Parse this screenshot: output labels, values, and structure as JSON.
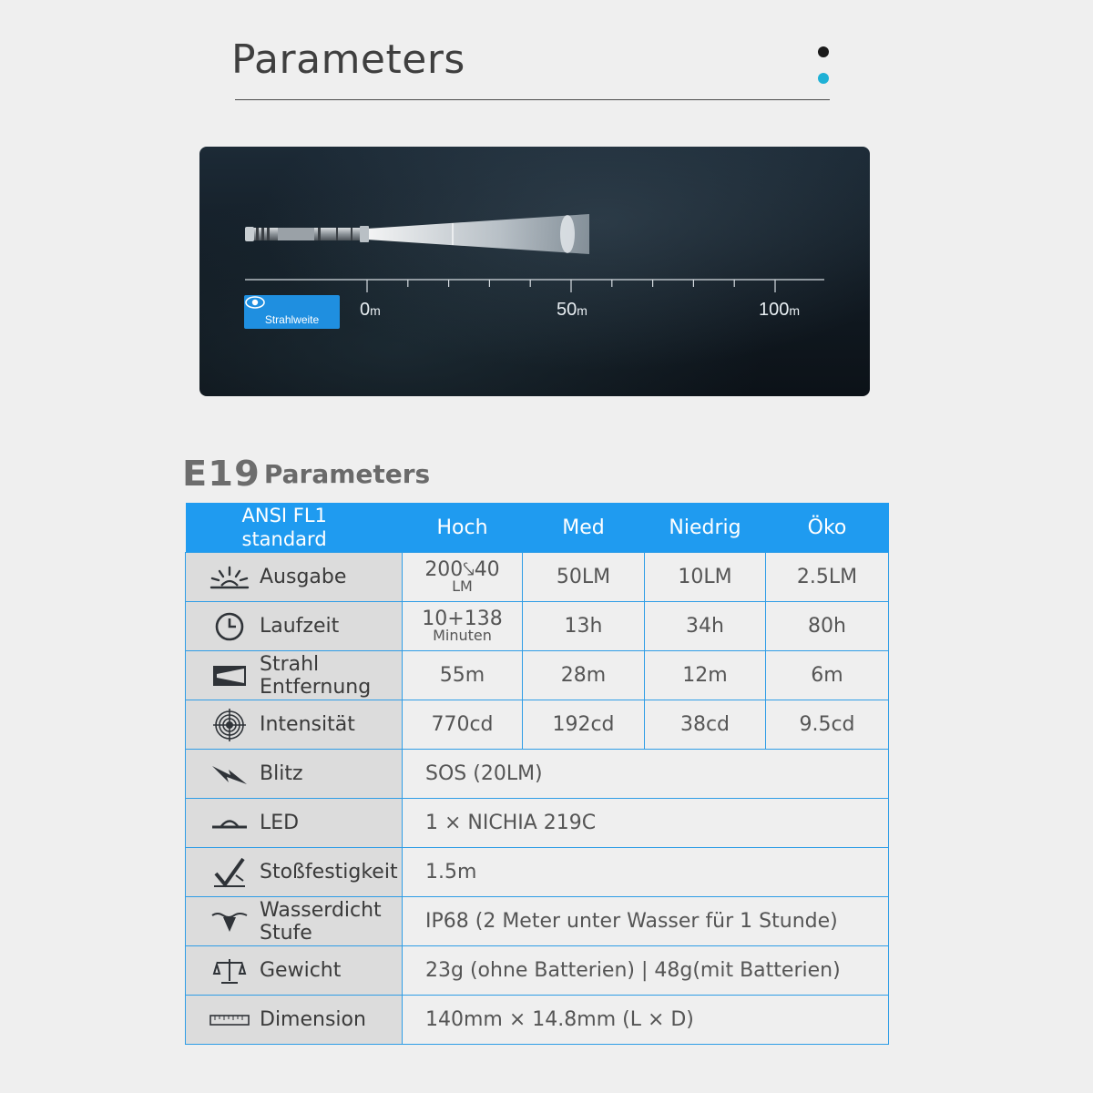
{
  "header": {
    "title": "Parameters"
  },
  "beam": {
    "badge_label": "Strahlweite",
    "marks": [
      {
        "value": "0",
        "unit": "m"
      },
      {
        "value": "50",
        "unit": "m"
      },
      {
        "value": "100",
        "unit": "m"
      }
    ]
  },
  "section": {
    "model": "E19",
    "title": "Parameters"
  },
  "table": {
    "header": {
      "first_line1": "ANSI FL1",
      "first_line2": "standard",
      "cols": [
        "Hoch",
        "Med",
        "Niedrig",
        "Öko"
      ]
    },
    "rows": {
      "ausgabe": {
        "label": "Ausgabe",
        "hoch_main": "200⤥40",
        "hoch_sub": "LM",
        "med": "50LM",
        "niedrig": "10LM",
        "oeko": "2.5LM"
      },
      "laufzeit": {
        "label": "Laufzeit",
        "hoch_main": "10+138",
        "hoch_sub": "Minuten",
        "med": "13h",
        "niedrig": "34h",
        "oeko": "80h"
      },
      "strahl": {
        "label_line1": "Strahl",
        "label_line2": "Entfernung",
        "hoch": "55m",
        "med": "28m",
        "niedrig": "12m",
        "oeko": "6m"
      },
      "intensitaet": {
        "label": "Intensität",
        "hoch": "770cd",
        "med": "192cd",
        "niedrig": "38cd",
        "oeko": "9.5cd"
      },
      "blitz": {
        "label": "Blitz",
        "value": "SOS (20LM)"
      },
      "led": {
        "label": "LED",
        "value": "1 × NICHIA 219C"
      },
      "stoss": {
        "label": "Stoßfestigkeit",
        "value": "1.5m"
      },
      "wasser": {
        "label_line1": "Wasserdicht",
        "label_line2": "Stufe",
        "value": "IP68 (2 Meter unter Wasser für 1 Stunde)"
      },
      "gewicht": {
        "label": "Gewicht",
        "value": "23g (ohne Batterien) | 48g(mit Batterien)"
      },
      "dimension": {
        "label": "Dimension",
        "value": "140mm × 14.8mm (L × D)"
      }
    }
  },
  "colors": {
    "accent": "#1f9bf0",
    "label_bg": "#dcdcdc",
    "page_bg": "#efefef",
    "dot_blue": "#1fb1d6"
  }
}
